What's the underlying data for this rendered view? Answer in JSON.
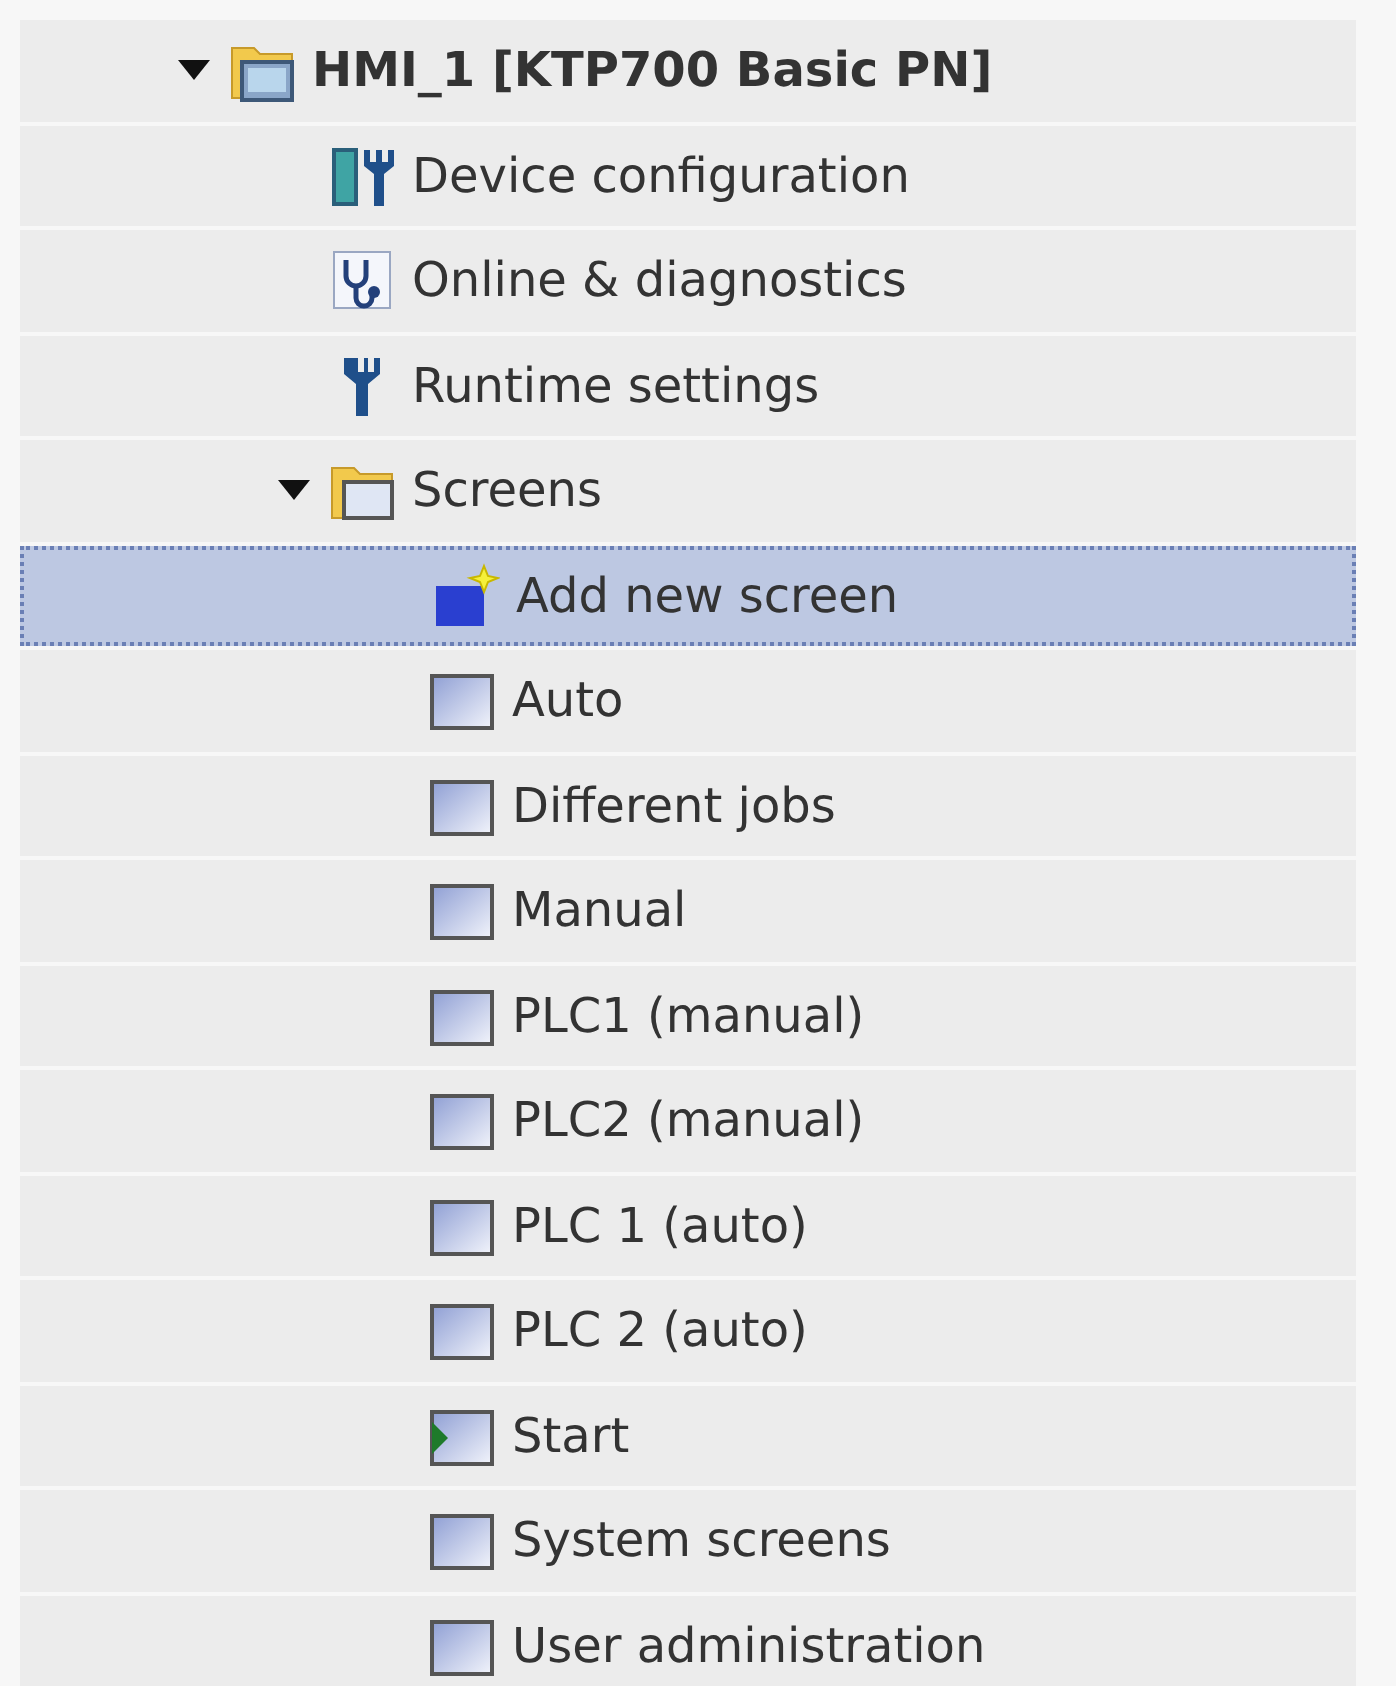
{
  "tree": [
    {
      "label": "HMI_1 [KTP700 Basic PN]",
      "kind": "device",
      "expanded": true,
      "selected": false,
      "children": [
        {
          "label": "Device configuration",
          "kind": "config",
          "selected": false
        },
        {
          "label": "Online & diagnostics",
          "kind": "diagnostics",
          "selected": false
        },
        {
          "label": "Runtime settings",
          "kind": "settings",
          "selected": false
        },
        {
          "label": "Screens",
          "kind": "folder",
          "expanded": true,
          "selected": false,
          "children": [
            {
              "label": "Add new screen",
              "kind": "add",
              "selected": true
            },
            {
              "label": "Auto",
              "kind": "screen",
              "selected": false
            },
            {
              "label": "Different jobs",
              "kind": "screen",
              "selected": false
            },
            {
              "label": "Manual",
              "kind": "screen",
              "selected": false
            },
            {
              "label": "PLC1 (manual)",
              "kind": "screen",
              "selected": false
            },
            {
              "label": "PLC2 (manual)",
              "kind": "screen",
              "selected": false
            },
            {
              "label": "PLC 1 (auto)",
              "kind": "screen",
              "selected": false
            },
            {
              "label": "PLC 2 (auto)",
              "kind": "screen",
              "selected": false
            },
            {
              "label": "Start",
              "kind": "start",
              "selected": false
            },
            {
              "label": "System screens",
              "kind": "screen",
              "selected": false
            },
            {
              "label": "User administration",
              "kind": "screen",
              "selected": false
            }
          ]
        }
      ]
    }
  ]
}
